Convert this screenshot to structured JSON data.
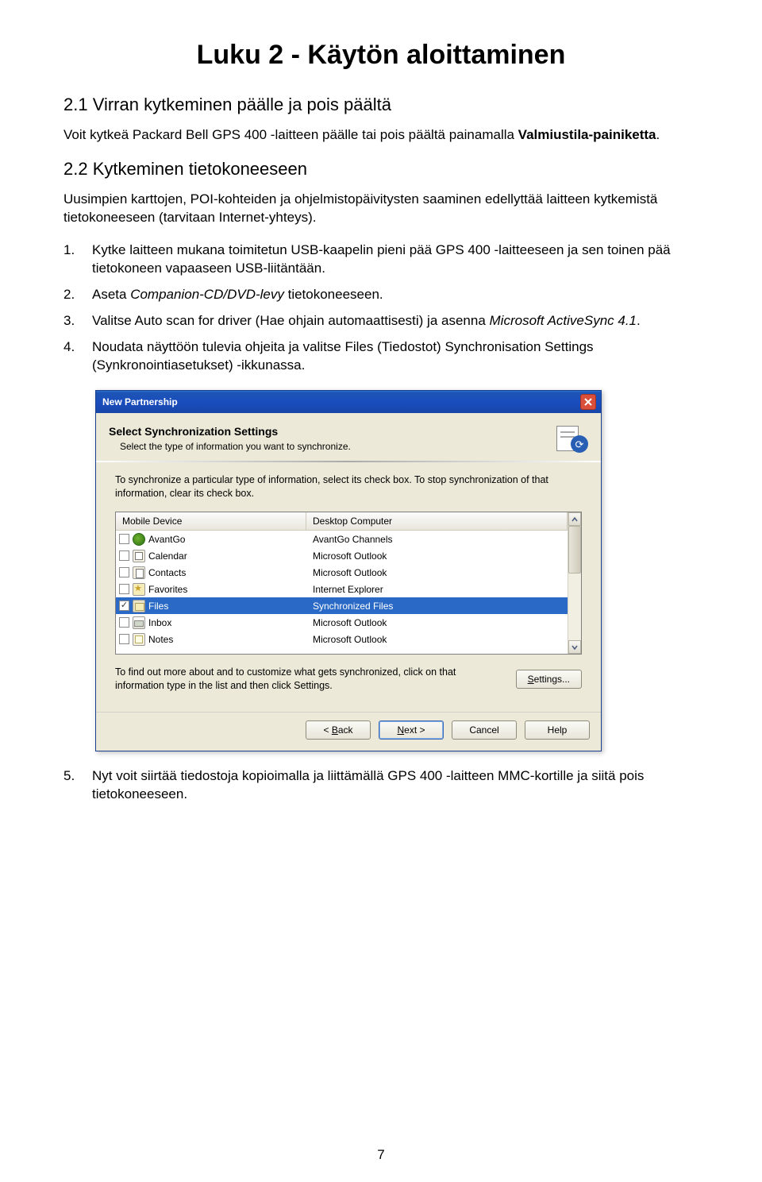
{
  "chapterTitle": "Luku 2 - Käytön aloittaminen",
  "section1": {
    "title": "2.1 Virran kytkeminen päälle ja pois päältä",
    "text_a": "Voit kytkeä Packard Bell GPS 400 -laitteen päälle tai pois päältä painamalla ",
    "text_b": "Valmiustila-painiketta",
    "text_c": "."
  },
  "section2": {
    "title": "2.2 Kytkeminen tietokoneeseen",
    "intro": "Uusimpien karttojen, POI-kohteiden ja ohjelmistopäivitysten saaminen edellyttää laitteen kytkemistä tietokoneeseen (tarvitaan Internet-yhteys)."
  },
  "steps": [
    {
      "num": "1.",
      "text": "Kytke laitteen mukana toimitetun USB-kaapelin pieni pää GPS 400 -laitteeseen ja sen toinen pää tietokoneen vapaaseen USB-liitäntään."
    },
    {
      "num": "2.",
      "text_a": "Aseta ",
      "italic": "Companion-CD/DVD-levy",
      "text_b": " tietokoneeseen."
    },
    {
      "num": "3.",
      "text_a": "Valitse Auto scan for driver (Hae ohjain automaattisesti) ja asenna ",
      "italic": "Microsoft ActiveSync 4.1",
      "text_b": "."
    },
    {
      "num": "4.",
      "text": "Noudata näyttöön tulevia ohjeita ja valitse Files (Tiedostot) Synchronisation Settings (Synkronointiasetukset) -ikkunassa."
    }
  ],
  "dialog": {
    "title": "New Partnership",
    "headerTitle": "Select Synchronization Settings",
    "headerSub": "Select the type of information you want to synchronize.",
    "info": "To synchronize a particular type of information, select its check box. To stop synchronization of that information, clear its check box.",
    "col1": "Mobile Device",
    "col2": "Desktop Computer",
    "rows": [
      {
        "checked": false,
        "icon": "avantgo",
        "label": "AvantGo",
        "desktop": "AvantGo Channels"
      },
      {
        "checked": false,
        "icon": "calendar",
        "label": "Calendar",
        "desktop": "Microsoft Outlook"
      },
      {
        "checked": false,
        "icon": "contacts",
        "label": "Contacts",
        "desktop": "Microsoft Outlook"
      },
      {
        "checked": false,
        "icon": "favorites",
        "label": "Favorites",
        "desktop": "Internet Explorer"
      },
      {
        "checked": true,
        "icon": "files",
        "label": "Files",
        "desktop": "Synchronized Files",
        "selected": true
      },
      {
        "checked": false,
        "icon": "inbox",
        "label": "Inbox",
        "desktop": "Microsoft Outlook"
      },
      {
        "checked": false,
        "icon": "notes",
        "label": "Notes",
        "desktop": "Microsoft Outlook"
      }
    ],
    "settingsText": "To find out more about and to customize what gets synchronized, click on that information type in the list and then click Settings.",
    "btnSettings_a": "S",
    "btnSettings_b": "ettings...",
    "btnBack_a": "< ",
    "btnBack_b": "B",
    "btnBack_c": "ack",
    "btnNext_a": "N",
    "btnNext_b": "ext >",
    "btnCancel": "Cancel",
    "btnHelp": "Help"
  },
  "step5": {
    "num": "5.",
    "text": "Nyt voit siirtää tiedostoja kopioimalla ja liittämällä GPS 400 -laitteen MMC-kortille ja siitä pois tietokoneeseen."
  },
  "pageNum": "7"
}
